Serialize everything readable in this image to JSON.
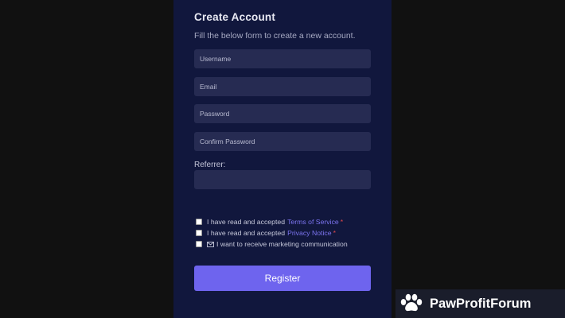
{
  "form": {
    "title": "Create Account",
    "subtitle": "Fill the below form to create a new account.",
    "username": {
      "placeholder": "Username",
      "value": ""
    },
    "email": {
      "placeholder": "Email",
      "value": ""
    },
    "password": {
      "placeholder": "Password",
      "value": ""
    },
    "confirm_password": {
      "placeholder": "Confirm Password",
      "value": ""
    },
    "referrer": {
      "label": "Referrer:",
      "value": ""
    },
    "terms": {
      "text": "I have read and accepted",
      "link": "Terms of Service",
      "required_mark": "*"
    },
    "privacy": {
      "text": "I have read and accepted",
      "link": "Privacy Notice",
      "required_mark": "*"
    },
    "marketing": {
      "icon": "mail-icon",
      "text": "I want to receive marketing communication"
    },
    "register_label": "Register"
  },
  "watermark": {
    "icon": "paw-icon",
    "name": "PawProfitForum"
  },
  "colors": {
    "page_bg": "#111111",
    "panel_bg": "#11173d",
    "field_bg": "#262b52",
    "accent": "#6e64ee",
    "link": "#7c74f0",
    "required": "#e0484c"
  }
}
